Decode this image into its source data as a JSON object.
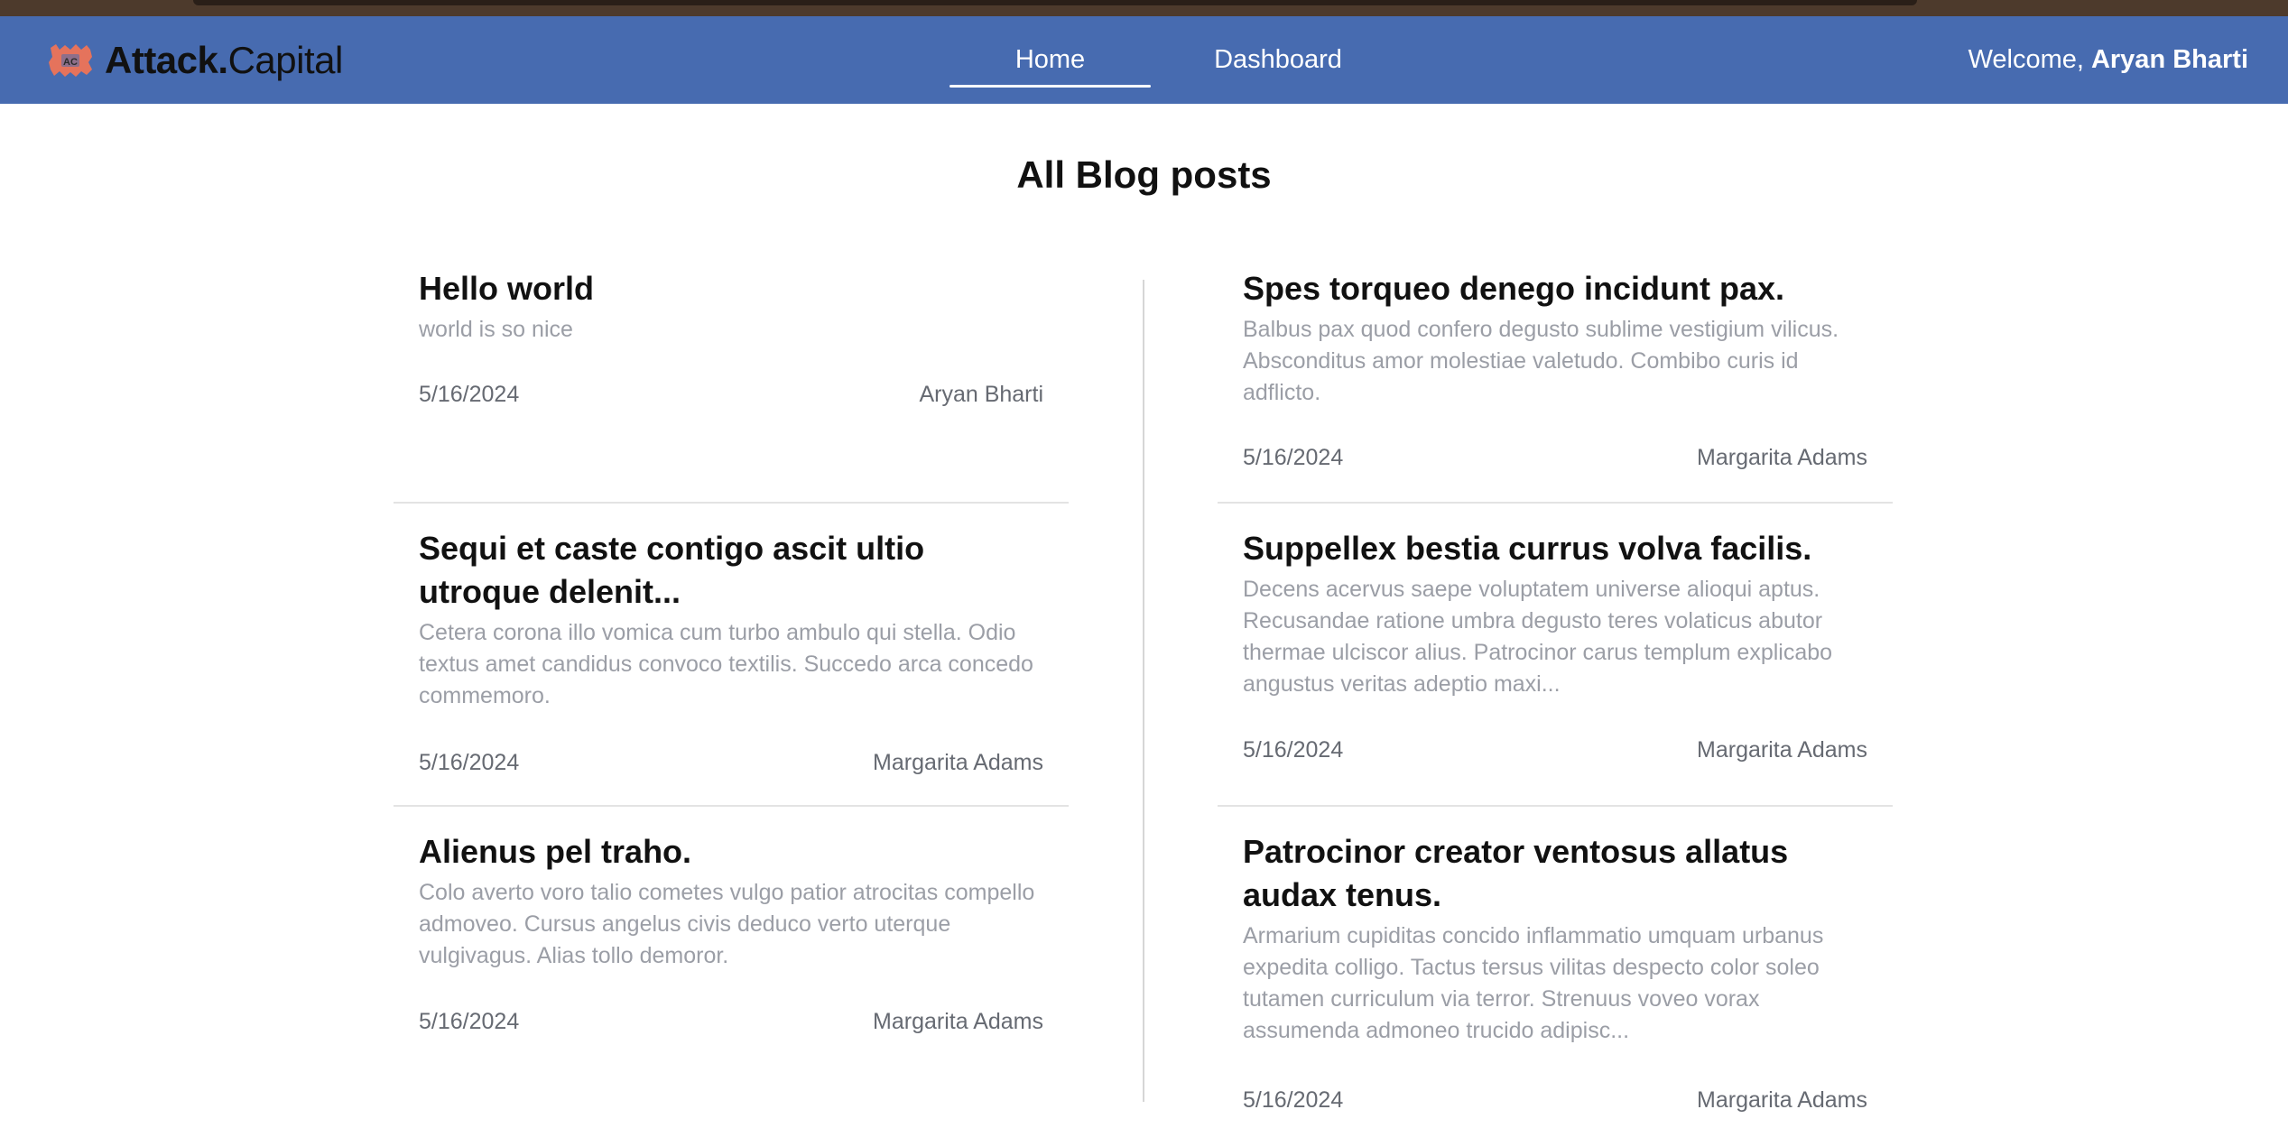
{
  "brand": {
    "name_bold": "Attack.",
    "name_light": "Capital",
    "accent": "#e5735c",
    "navbar_bg": "#476bb0"
  },
  "nav": {
    "items": [
      {
        "label": "Home",
        "active": true
      },
      {
        "label": "Dashboard",
        "active": false
      }
    ]
  },
  "user": {
    "greeting": "Welcome,",
    "name": "Aryan Bharti"
  },
  "page": {
    "title": "All Blog posts"
  },
  "posts": {
    "left": [
      {
        "title": "Hello world",
        "excerpt": "world is so nice",
        "date": "5/16/2024",
        "author": "Aryan Bharti"
      },
      {
        "title": "Sequi et caste contigo ascit ultio utroque delenit...",
        "excerpt": "Cetera corona illo vomica cum turbo ambulo qui stella. Odio textus amet candidus convoco textilis. Succedo arca concedo commemoro.",
        "date": "5/16/2024",
        "author": "Margarita Adams"
      },
      {
        "title": "Alienus pel traho.",
        "excerpt": "Colo averto voro talio cometes vulgo patior atrocitas compello admoveo. Cursus angelus civis deduco verto uterque vulgivagus. Alias tollo demoror.",
        "date": "5/16/2024",
        "author": "Margarita Adams"
      }
    ],
    "right": [
      {
        "title": "Spes torqueo denego incidunt pax.",
        "excerpt": "Balbus pax quod confero degusto sublime vestigium vilicus. Absconditus amor molestiae valetudo. Combibo curis id adflicto.",
        "date": "5/16/2024",
        "author": "Margarita Adams"
      },
      {
        "title": "Suppellex bestia currus volva facilis.",
        "excerpt": "Decens acervus saepe voluptatem universe alioqui aptus. Recusandae ratione umbra degusto teres volaticus abutor thermae ulciscor alius. Patrocinor carus templum explicabo angustus veritas adeptio maxi...",
        "date": "5/16/2024",
        "author": "Margarita Adams"
      },
      {
        "title": "Patrocinor creator ventosus allatus audax tenus.",
        "excerpt": "Armarium cupiditas concido inflammatio umquam urbanus expedita colligo. Tactus tersus vilitas despecto color soleo tutamen curriculum via terror. Strenuus voveo vorax assumenda admoneo trucido adipisc...",
        "date": "5/16/2024",
        "author": "Margarita Adams"
      }
    ]
  }
}
